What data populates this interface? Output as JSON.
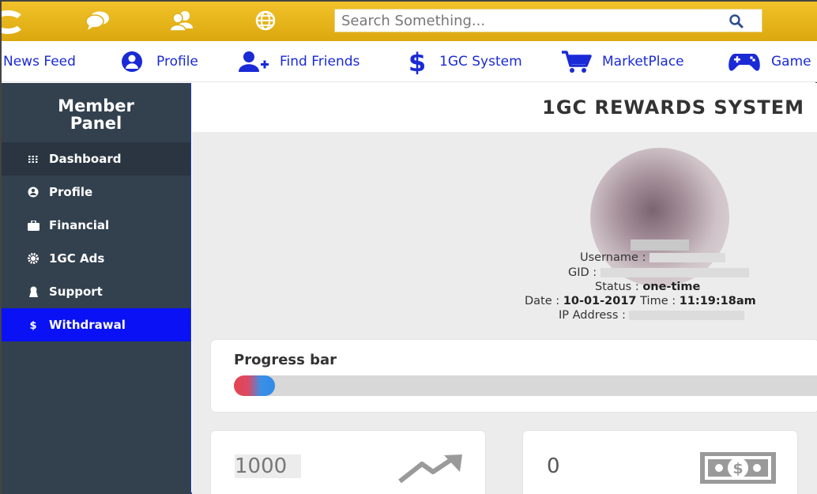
{
  "search": {
    "placeholder": "Search Something..."
  },
  "top_icons": [
    "chat-icon",
    "group-icon",
    "globe-icon"
  ],
  "nav": {
    "items": [
      {
        "label": "News Feed",
        "icon": ""
      },
      {
        "label": "Profile",
        "icon": "user-icon"
      },
      {
        "label": "Find Friends",
        "icon": "add-friend-icon"
      },
      {
        "label": "1GC System",
        "icon": "dollar-icon"
      },
      {
        "label": "MarketPlace",
        "icon": "cart-icon"
      },
      {
        "label": "Game",
        "icon": "gamepad-icon"
      }
    ]
  },
  "sidebar": {
    "title_line1": "Member",
    "title_line2": "Panel",
    "items": [
      {
        "label": "Dashboard",
        "icon": "grid-icon"
      },
      {
        "label": "Profile",
        "icon": "profile-icon"
      },
      {
        "label": "Financial",
        "icon": "briefcase-icon"
      },
      {
        "label": "1GC Ads",
        "icon": "gear-icon"
      },
      {
        "label": "Support",
        "icon": "support-icon"
      },
      {
        "label": "Withdrawal",
        "icon": "dollar-icon"
      }
    ]
  },
  "main": {
    "title": "1GC REWARDS SYSTEM",
    "profile": {
      "username_label": "Username :",
      "gid_label": "GID :",
      "status_label": "Status :",
      "status_value": "one-time",
      "date_label": "Date :",
      "date_value": "10-01-2017",
      "time_label": "Time :",
      "time_value": "11:19:18am",
      "ip_label": "IP Address :"
    },
    "progress": {
      "label": "Progress bar",
      "percent": 7
    },
    "stats": [
      {
        "value": "1000",
        "icon": "trend-up-icon"
      },
      {
        "value": "0",
        "icon": "money-icon"
      }
    ]
  },
  "colors": {
    "topbar": "#e1ad14",
    "nav_text": "#1a2ad6",
    "sidebar_bg": "#33414f",
    "sidebar_active": "#0a12f5"
  }
}
